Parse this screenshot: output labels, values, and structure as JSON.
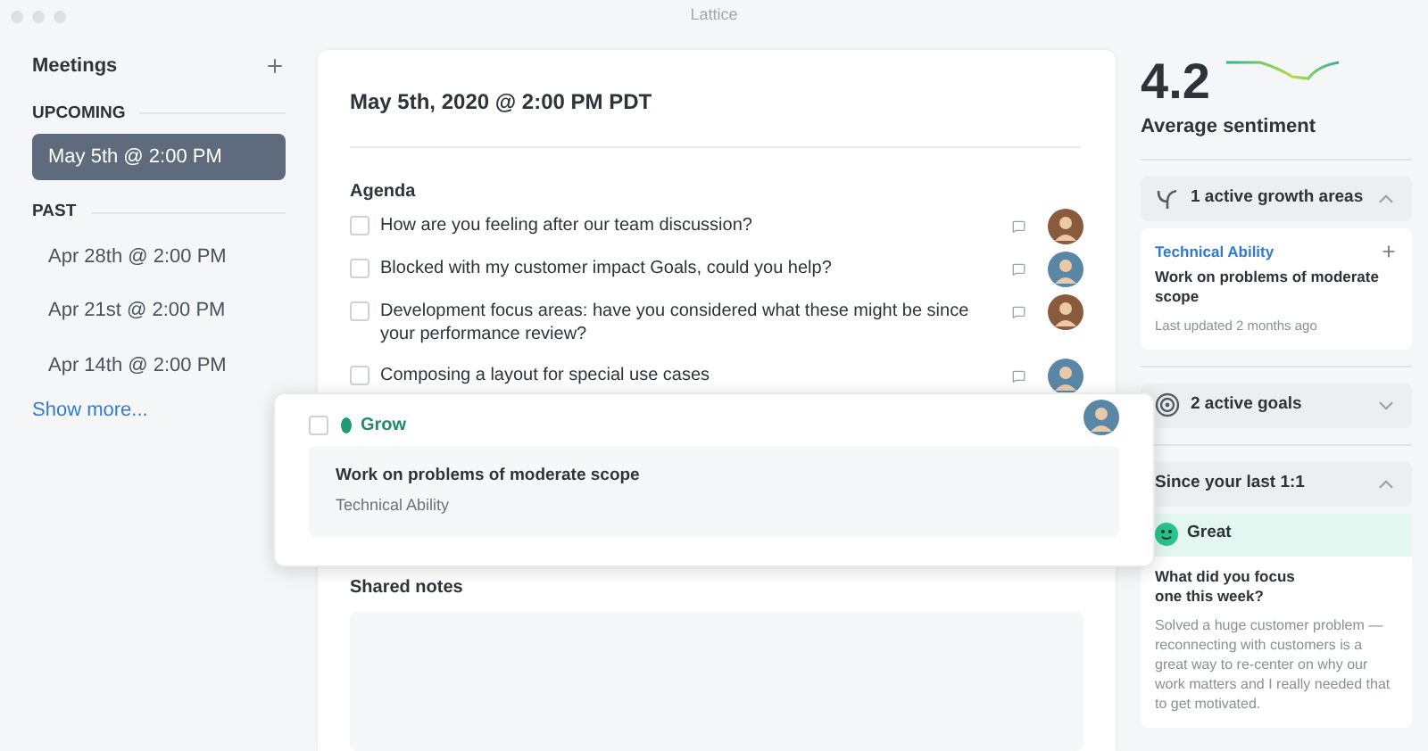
{
  "window": {
    "title": "Lattice"
  },
  "sidebar": {
    "title": "Meetings",
    "upcoming_label": "UPCOMING",
    "upcoming": [
      {
        "label": "May 5th @ 2:00 PM",
        "selected": true
      }
    ],
    "past_label": "PAST",
    "past": [
      {
        "label": "Apr 28th @ 2:00 PM",
        "selected": false
      },
      {
        "label": "Apr 21st @ 2:00 PM",
        "selected": false
      },
      {
        "label": "Apr 14th @ 2:00 PM",
        "selected": false
      }
    ],
    "show_more": "Show more..."
  },
  "meeting": {
    "title": "May 5th, 2020 @ 2:00 PM PDT",
    "agenda_label": "Agenda",
    "agenda": [
      {
        "text": "How are you feeling after our team discussion?",
        "checked": false,
        "color": "#8a5a3c"
      },
      {
        "text": "Blocked with my customer impact Goals, could you help?",
        "checked": false,
        "color": "#5b87a6"
      },
      {
        "text": "Development focus areas: have you considered what these might be since your performance review?",
        "checked": false,
        "color": "#8a5a3c"
      },
      {
        "text": "Composing a layout for special use cases",
        "checked": false,
        "color": "#5b87a6"
      }
    ],
    "shared_notes_label": "Shared notes"
  },
  "popup": {
    "checked": false,
    "tag": "Grow",
    "goal": "Work on problems of moderate scope",
    "area": "Technical Ability"
  },
  "insights": {
    "score": "4.2",
    "score_label": "Average sentiment",
    "sections": [
      {
        "kind": "growth",
        "title": "1 active growth areas",
        "expanded": true,
        "card": {
          "area": "Technical Ability",
          "goal": "Work on problems of moderate scope",
          "updated": "Last updated 2 months ago"
        }
      },
      {
        "kind": "goals",
        "title": "2 active goals",
        "expanded": false
      },
      {
        "kind": "checkin",
        "title": "Since your last 1:1",
        "expanded": true,
        "mood": "Great",
        "question": "What did you focus one this week?",
        "answer": "Solved a huge customer problem — reconnecting with customers is a great way to re-center on why our work matters and I really needed that to get motivated."
      }
    ]
  }
}
